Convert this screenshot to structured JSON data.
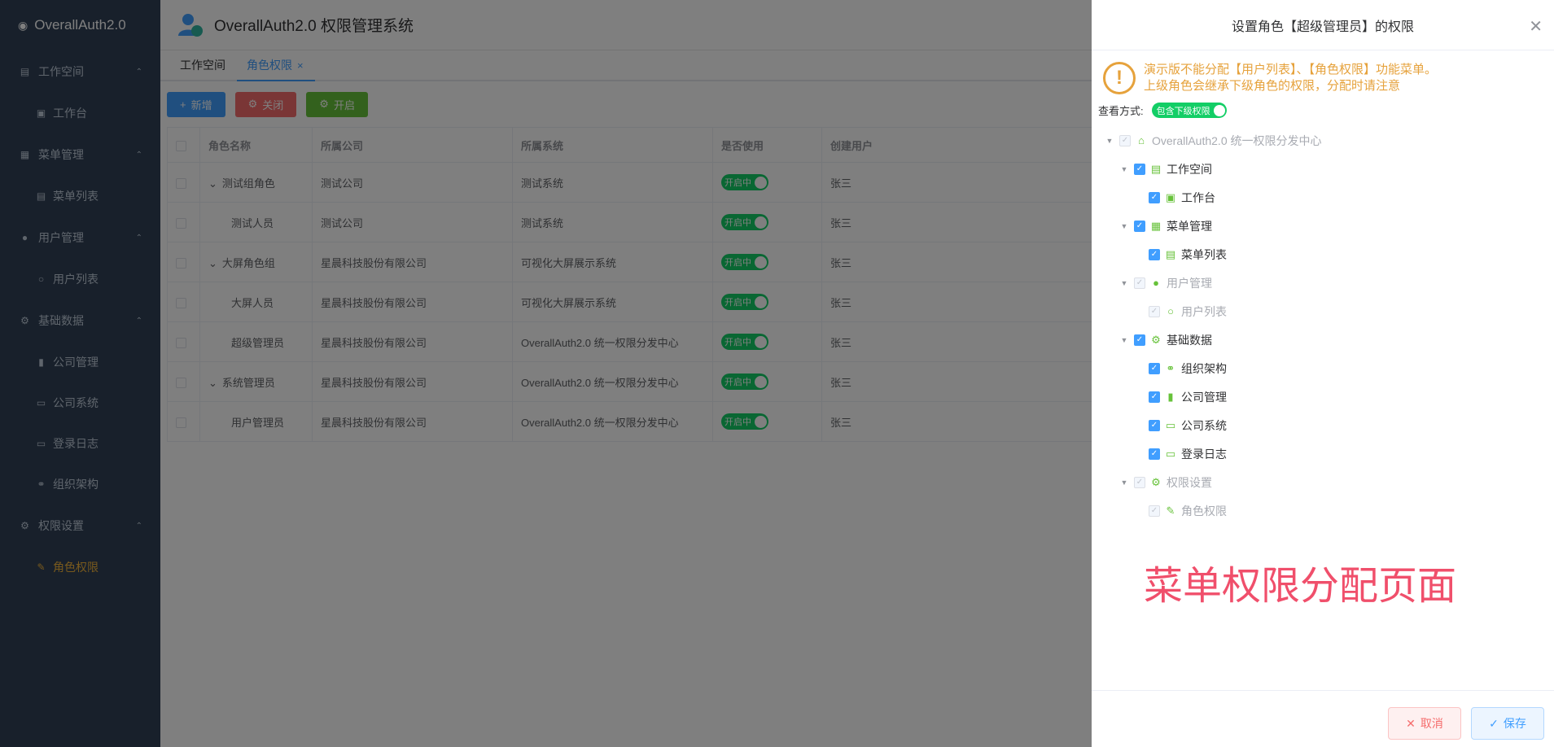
{
  "app": {
    "brand": "OverallAuth2.0",
    "header_title": "OverallAuth2.0 权限管理系统"
  },
  "sidebar": {
    "groups": [
      {
        "label": "工作空间",
        "icon": "document-icon",
        "items": [
          {
            "label": "工作台",
            "icon": "dashboard-icon"
          }
        ]
      },
      {
        "label": "菜单管理",
        "icon": "grid-icon",
        "items": [
          {
            "label": "菜单列表",
            "icon": "list-icon"
          }
        ]
      },
      {
        "label": "用户管理",
        "icon": "user-icon",
        "items": [
          {
            "label": "用户列表",
            "icon": "user-outline-icon"
          }
        ]
      },
      {
        "label": "基础数据",
        "icon": "gear-icon",
        "items": [
          {
            "label": "公司管理",
            "icon": "bar-chart-icon"
          },
          {
            "label": "公司系统",
            "icon": "monitor-icon"
          },
          {
            "label": "登录日志",
            "icon": "monitor-icon"
          },
          {
            "label": "组织架构",
            "icon": "link-icon"
          }
        ]
      },
      {
        "label": "权限设置",
        "icon": "gear-icon",
        "items": [
          {
            "label": "角色权限",
            "icon": "edit-icon"
          }
        ]
      }
    ]
  },
  "tabs": [
    {
      "label": "工作空间"
    },
    {
      "label": "角色权限",
      "close": "×"
    }
  ],
  "toolbar": {
    "add_label": "新增",
    "close_label": "关闭",
    "open_label": "开启"
  },
  "table": {
    "columns": [
      "角色名称",
      "所属公司",
      "所属系统",
      "是否使用",
      "创建用户"
    ],
    "rows": [
      {
        "name": "测试组角色",
        "company": "测试公司",
        "system": "测试系统",
        "status": "开启中",
        "creator": "张三",
        "expand": "⌄"
      },
      {
        "name": "测试人员",
        "company": "测试公司",
        "system": "测试系统",
        "status": "开启中",
        "creator": "张三",
        "expand": ""
      },
      {
        "name": "大屏角色组",
        "company": "星晨科技股份有限公司",
        "system": "可视化大屏展示系统",
        "status": "开启中",
        "creator": "张三",
        "expand": "⌄"
      },
      {
        "name": "大屏人员",
        "company": "星晨科技股份有限公司",
        "system": "可视化大屏展示系统",
        "status": "开启中",
        "creator": "张三",
        "expand": ""
      },
      {
        "name": "超级管理员",
        "company": "星晨科技股份有限公司",
        "system": "OverallAuth2.0 统一权限分发中心",
        "status": "开启中",
        "creator": "张三",
        "expand": ""
      },
      {
        "name": "系统管理员",
        "company": "星晨科技股份有限公司",
        "system": "OverallAuth2.0 统一权限分发中心",
        "status": "开启中",
        "creator": "张三",
        "expand": "⌄"
      },
      {
        "name": "用户管理员",
        "company": "星晨科技股份有限公司",
        "system": "OverallAuth2.0 统一权限分发中心",
        "status": "开启中",
        "creator": "张三",
        "expand": ""
      }
    ]
  },
  "drawer": {
    "title": "设置角色【超级管理员】的权限",
    "warning_line1": "演示版不能分配【用户列表】、【角色权限】功能菜单。",
    "warning_line2": "上级角色会继承下级角色的权限，分配时请注意",
    "view_mode_label": "查看方式:",
    "view_mode_switch": "包含下级权限",
    "tree": [
      {
        "label": "OverallAuth2.0 统一权限分发中心",
        "level": 0,
        "state": "disabled",
        "icon": "home-icon"
      },
      {
        "label": "工作空间",
        "level": 1,
        "state": "checked",
        "icon": "document-icon"
      },
      {
        "label": "工作台",
        "level": 2,
        "state": "checked",
        "icon": "dashboard-icon"
      },
      {
        "label": "菜单管理",
        "level": 1,
        "state": "checked",
        "icon": "grid-icon"
      },
      {
        "label": "菜单列表",
        "level": 2,
        "state": "checked",
        "icon": "list-icon"
      },
      {
        "label": "用户管理",
        "level": 1,
        "state": "disabled",
        "icon": "user-icon"
      },
      {
        "label": "用户列表",
        "level": 2,
        "state": "disabled",
        "icon": "user-outline-icon"
      },
      {
        "label": "基础数据",
        "level": 1,
        "state": "checked",
        "icon": "gear-icon"
      },
      {
        "label": "组织架构",
        "level": 2,
        "state": "checked",
        "icon": "link-icon"
      },
      {
        "label": "公司管理",
        "level": 2,
        "state": "checked",
        "icon": "bar-chart-icon"
      },
      {
        "label": "公司系统",
        "level": 2,
        "state": "checked",
        "icon": "monitor-icon"
      },
      {
        "label": "登录日志",
        "level": 2,
        "state": "checked",
        "icon": "monitor-icon"
      },
      {
        "label": "权限设置",
        "level": 1,
        "state": "disabled",
        "icon": "gear-icon"
      },
      {
        "label": "角色权限",
        "level": 2,
        "state": "disabled",
        "icon": "edit-icon"
      }
    ],
    "big_label": "菜单权限分配页面",
    "cancel_label": "取消",
    "save_label": "保存"
  },
  "colors": {
    "sidebar_bg": "#304156",
    "active_menu": "#f0b33b",
    "primary": "#409eff",
    "success": "#13ce66",
    "warning": "#e6a23c",
    "danger": "#f56c6c",
    "overlay_label": "#f04f6b"
  }
}
